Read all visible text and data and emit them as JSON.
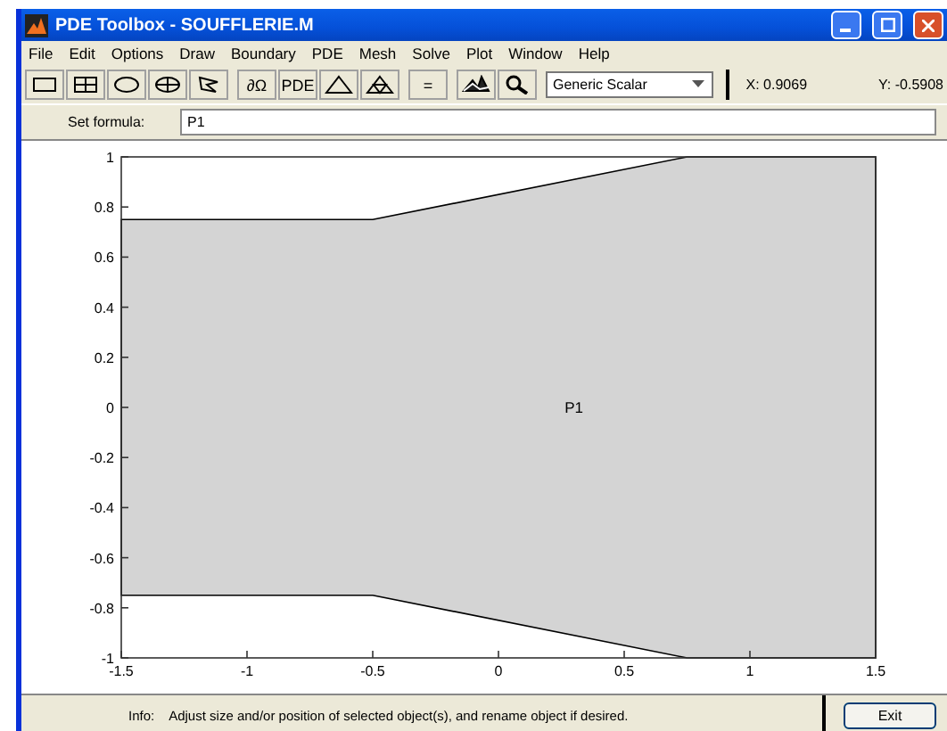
{
  "window": {
    "title": "PDE Toolbox - SOUFFLERIE.M"
  },
  "menu": [
    "File",
    "Edit",
    "Options",
    "Draw",
    "Boundary",
    "PDE",
    "Mesh",
    "Solve",
    "Plot",
    "Window",
    "Help"
  ],
  "toolbar": [
    {
      "kind": "rect"
    },
    {
      "kind": "square"
    },
    {
      "kind": "ellipse"
    },
    {
      "kind": "circle"
    },
    {
      "kind": "polygon"
    },
    {
      "kind": "text",
      "label": "∂Ω"
    },
    {
      "kind": "text",
      "label": "PDE"
    },
    {
      "kind": "triangle"
    },
    {
      "kind": "refine"
    },
    {
      "kind": "text",
      "label": "="
    },
    {
      "kind": "mesh3d"
    },
    {
      "kind": "zoom"
    }
  ],
  "mode_select": {
    "value": "Generic Scalar"
  },
  "coordinates": {
    "x": "X:  0.9069",
    "y": "Y:  -0.5908"
  },
  "formula": {
    "label": "Set formula:",
    "value": "P1"
  },
  "plot": {
    "x_ticks": [
      "-1.5",
      "-1",
      "-0.5",
      "0",
      "0.5",
      "1",
      "1.5"
    ],
    "y_ticks": [
      "1",
      "0.8",
      "0.6",
      "0.4",
      "0.2",
      "0",
      "-0.2",
      "-0.4",
      "-0.6",
      "-0.8",
      "-1"
    ],
    "object_label": "P1"
  },
  "status": {
    "label": "Info:",
    "message": "Adjust size and/or position of selected object(s), and rename object if desired."
  },
  "buttons": [
    "Exit"
  ]
}
